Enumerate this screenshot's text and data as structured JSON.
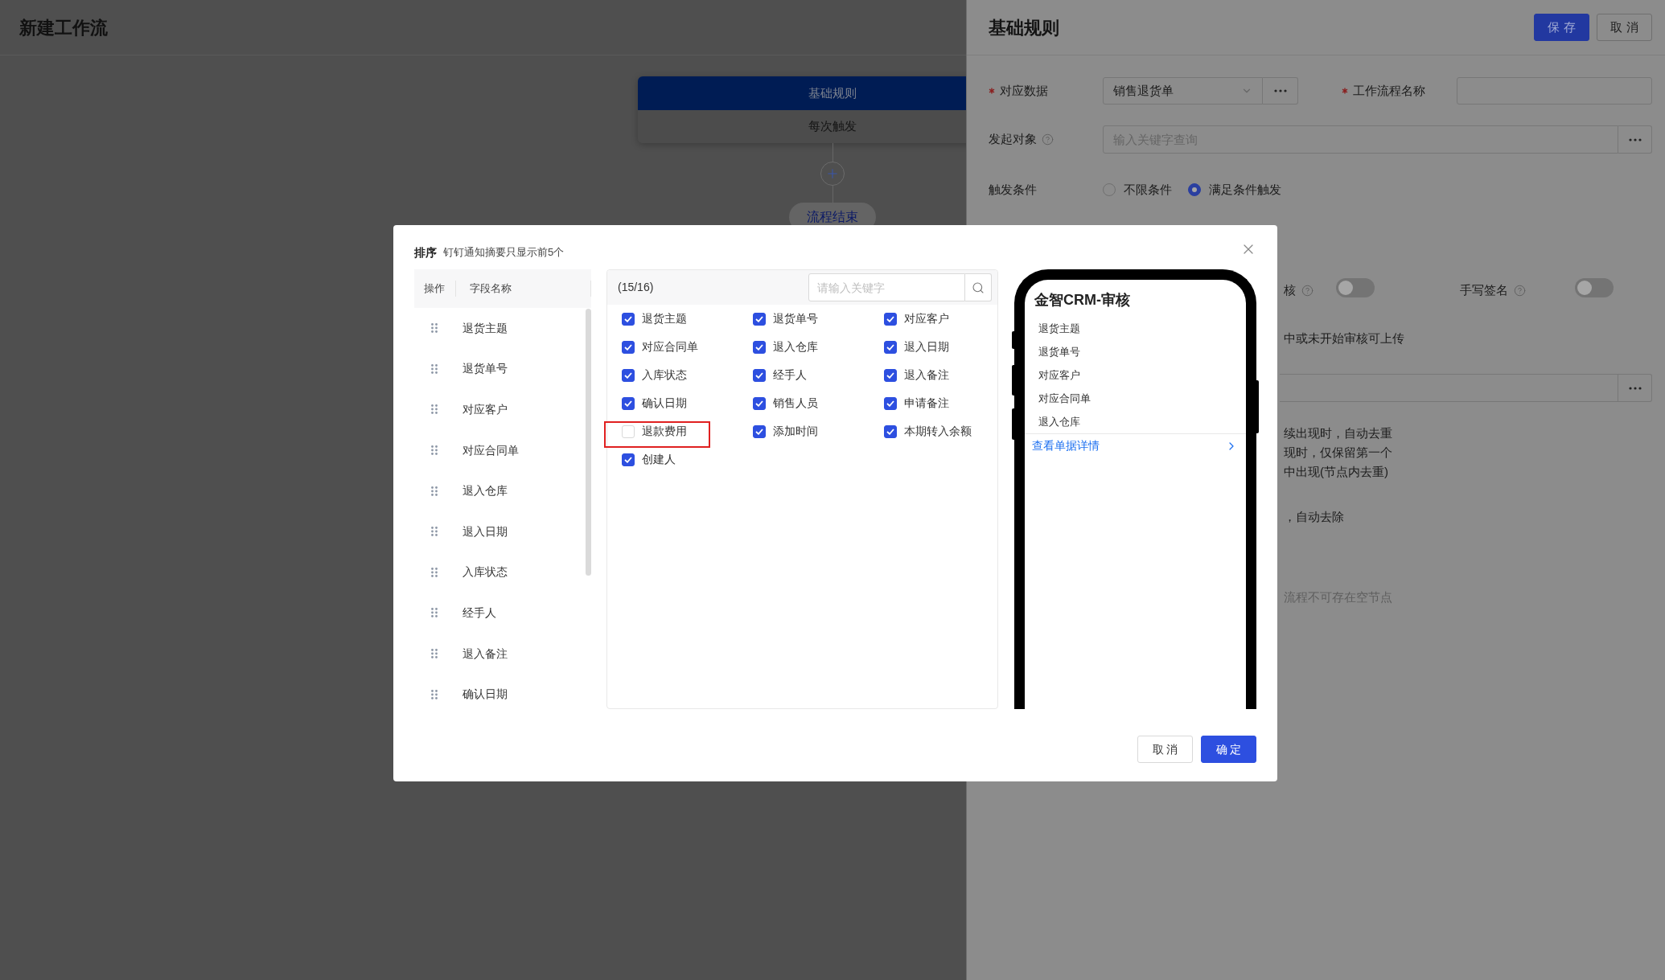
{
  "page": {
    "title": "新建工作流"
  },
  "flow": {
    "start_node": {
      "title": "基础规则",
      "trigger": "每次触发"
    },
    "end_node": {
      "label": "流程结束"
    }
  },
  "drawer": {
    "title": "基础规则",
    "buttons": [
      {
        "label": "保 存",
        "kind": "primary"
      },
      {
        "label": "取 消",
        "kind": "default"
      }
    ],
    "data_source": {
      "label": "对应数据",
      "required": true,
      "value": "销售退货单"
    },
    "workflow_name": {
      "label": "工作流程名称",
      "required": true
    },
    "initiator": {
      "label": "发起对象",
      "placeholder": "输入关键字查询"
    },
    "trigger": {
      "label": "触发条件",
      "options": [
        {
          "label": "不限条件",
          "selected": false
        },
        {
          "label": "满足条件触发",
          "selected": true
        }
      ]
    },
    "switches": [
      {
        "label": "核",
        "on": false
      },
      {
        "label": "手写签名",
        "on": false
      }
    ],
    "upload_note": "中或未开始审核可上传",
    "dedupe_notes": [
      "续出现时，自动去重",
      "现时，仅保留第一个",
      "中出现(节点内去重)"
    ],
    "removal_note": "，自动去除",
    "empty_node_note": "流程不可存在空节点"
  },
  "modal": {
    "title": "排序",
    "subtitle": "钉钉通知摘要只显示前5个",
    "sort_table": {
      "columns": [
        "操作",
        "字段名称"
      ],
      "rows": [
        "退货主题",
        "退货单号",
        "对应客户",
        "对应合同单",
        "退入仓库",
        "退入日期",
        "入库状态",
        "经手人",
        "退入备注",
        "确认日期"
      ]
    },
    "picker": {
      "count": "(15/16)",
      "search_placeholder": "请输入关键字",
      "fields": [
        {
          "label": "退货主题",
          "checked": true,
          "highlighted": false
        },
        {
          "label": "退货单号",
          "checked": true,
          "highlighted": false
        },
        {
          "label": "对应客户",
          "checked": true,
          "highlighted": false
        },
        {
          "label": "对应合同单",
          "checked": true,
          "highlighted": false
        },
        {
          "label": "退入仓库",
          "checked": true,
          "highlighted": false
        },
        {
          "label": "退入日期",
          "checked": true,
          "highlighted": false
        },
        {
          "label": "入库状态",
          "checked": true,
          "highlighted": false
        },
        {
          "label": "经手人",
          "checked": true,
          "highlighted": false
        },
        {
          "label": "退入备注",
          "checked": true,
          "highlighted": false
        },
        {
          "label": "确认日期",
          "checked": true,
          "highlighted": false
        },
        {
          "label": "销售人员",
          "checked": true,
          "highlighted": false
        },
        {
          "label": "申请备注",
          "checked": true,
          "highlighted": false
        },
        {
          "label": "退款费用",
          "checked": false,
          "highlighted": true
        },
        {
          "label": "添加时间",
          "checked": true,
          "highlighted": false
        },
        {
          "label": "本期转入余额",
          "checked": true,
          "highlighted": false
        },
        {
          "label": "创建人",
          "checked": true,
          "highlighted": false
        }
      ]
    },
    "preview": {
      "title": "金智CRM-审核",
      "items": [
        "退货主题",
        "退货单号",
        "对应客户",
        "对应合同单",
        "退入仓库"
      ],
      "link": "查看单据详情"
    },
    "buttons": [
      {
        "label": "取 消",
        "kind": "default"
      },
      {
        "label": "确 定",
        "kind": "primary"
      }
    ]
  }
}
